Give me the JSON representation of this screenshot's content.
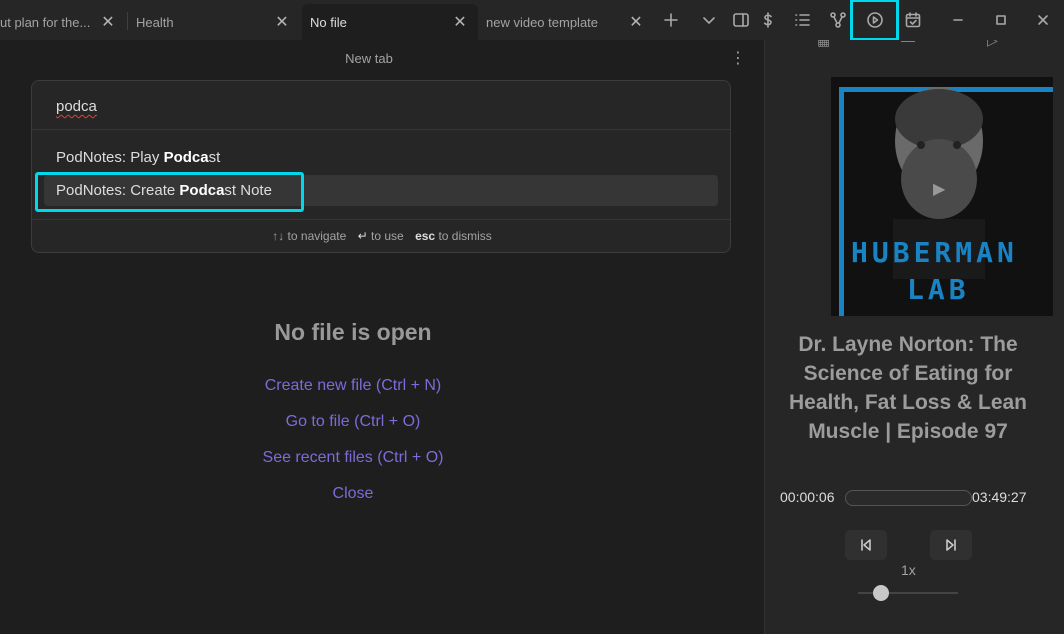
{
  "tabs": [
    {
      "label": "ut plan for the...",
      "active": false
    },
    {
      "label": "Health",
      "active": false
    },
    {
      "label": "No file",
      "active": true
    },
    {
      "label": "new video template",
      "active": false
    }
  ],
  "toolbar_icons": [
    "plus-icon",
    "chevron-down-icon",
    "sidebar-toggle-icon",
    "dollar-icon",
    "list-icon",
    "graph-icon",
    "play-circle-icon",
    "calendar-icon",
    "minimize-icon",
    "maximize-icon",
    "close-window-icon"
  ],
  "pane": {
    "title": "New tab",
    "empty_title": "No file is open",
    "links": [
      "Create new file (Ctrl + N)",
      "Go to file (Ctrl + O)",
      "See recent files (Ctrl + O)",
      "Close"
    ]
  },
  "palette": {
    "query": "podca",
    "items": [
      {
        "prefix": "PodNotes: Play ",
        "match": "Podca",
        "suffix": "st",
        "selected": false
      },
      {
        "prefix": "PodNotes: Create ",
        "match": "Podca",
        "suffix": "st Note",
        "selected": true
      }
    ],
    "hints": {
      "navigate_key": "↑↓",
      "navigate_text": "to navigate",
      "use_key": "↵",
      "use_text": "to use",
      "dismiss_key": "esc",
      "dismiss_text": "to dismiss"
    }
  },
  "player": {
    "artwork_text_1": "HUBERMAN",
    "artwork_text_2": "LAB",
    "episode_title": "Dr. Layne Norton: The Science of Eating for Health, Fat Loss & Lean Muscle | Episode 97",
    "current_time": "00:00:06",
    "total_time": "03:49:27",
    "progress_fraction": 0.0,
    "playback_rate": "1x",
    "accent_color": "#1a83c4"
  },
  "colors": {
    "highlight": "#00d9ec",
    "link": "#7b6cd9"
  }
}
